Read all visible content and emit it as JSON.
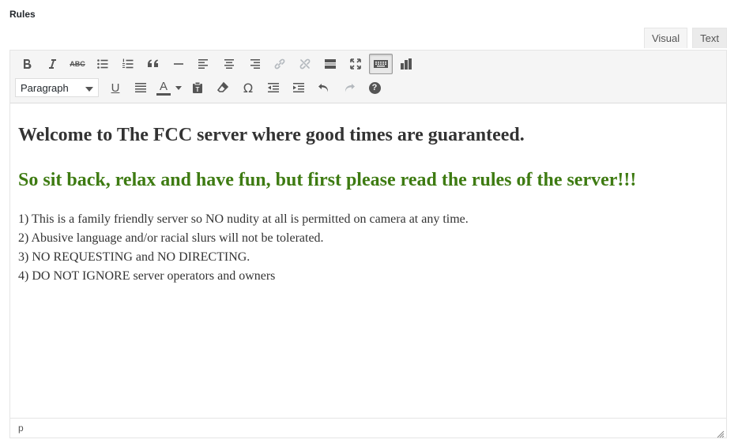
{
  "field": {
    "label": "Rules"
  },
  "tabs": [
    {
      "label": "Visual",
      "active": true
    },
    {
      "label": "Text",
      "active": false
    }
  ],
  "toolbar": {
    "row1": [
      "bold-icon",
      "italic-icon",
      "strikethrough-icon",
      "bullet-list-icon",
      "numbered-list-icon",
      "blockquote-icon",
      "horizontal-line-icon",
      "align-left-icon",
      "align-center-icon",
      "align-right-icon",
      "link-icon",
      "unlink-icon",
      "read-more-icon",
      "fullscreen-icon",
      "toolbar-toggle-icon",
      "chart-icon"
    ],
    "format_value": "Paragraph",
    "strike_label": "ABC",
    "underline_label": "U",
    "text_color_label": "A",
    "special_char_label": "Ω",
    "help_label": "?"
  },
  "content": {
    "heading": "Welcome to The FCC server where good times are guaranteed.",
    "subheading": "So sit back, relax and have fun, but first please read the rules of the server!!!",
    "rules": [
      "1) This is a family friendly server so NO nudity at all is permitted on camera at any time.",
      "2) Abusive language and/or racial slurs will not be tolerated.",
      "3) NO REQUESTING and NO DIRECTING.",
      "4) DO NOT IGNORE server operators and owners"
    ]
  },
  "statusbar": {
    "path": "p"
  },
  "colors": {
    "subheading": "#3e7b12",
    "toolbar_bg": "#f5f5f5",
    "icon": "#555555"
  }
}
